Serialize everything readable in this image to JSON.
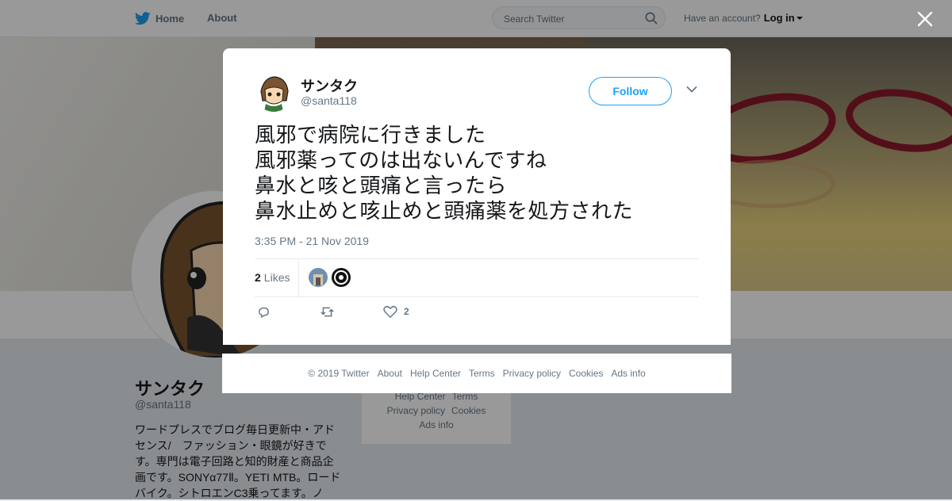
{
  "nav": {
    "home_label": "Home",
    "about_label": "About",
    "search_placeholder": "Search Twitter",
    "account_prompt": "Have an account?",
    "login_label": "Log in"
  },
  "profile": {
    "name": "サンタク",
    "handle": "@santa118",
    "bio": "ワードプレスでブログ毎日更新中・アドセンス/　ファッション・眼鏡が好きです。専門は電子回路と知的財産と商品企画です。SONYα77Ⅱ。YETI MTB。ロードバイク。シトロエンC3乗ってます。ノ"
  },
  "mini_footer": {
    "row1": [
      "Help Center",
      "Terms"
    ],
    "row2": [
      "Privacy policy",
      "Cookies"
    ],
    "row3": [
      "Ads info"
    ]
  },
  "tweet": {
    "name": "サンタク",
    "handle": "@santa118",
    "follow_label": "Follow",
    "text": "風邪で病院に行きました\n風邪薬ってのは出ないんですね\n鼻水と咳と頭痛と言ったら\n鼻水止めと咳止めと頭痛薬を処方された",
    "timestamp": "3:35 PM - 21 Nov 2019",
    "likes_count": "2",
    "likes_label": "Likes",
    "like_action_count": "2"
  },
  "footer": {
    "links": [
      "© 2019 Twitter",
      "About",
      "Help Center",
      "Terms",
      "Privacy policy",
      "Cookies",
      "Ads info"
    ]
  },
  "colors": {
    "accent": "#1da1f2",
    "muted": "#657786",
    "text": "#14171a",
    "overlay": "rgba(0,0,0,0.40)"
  }
}
